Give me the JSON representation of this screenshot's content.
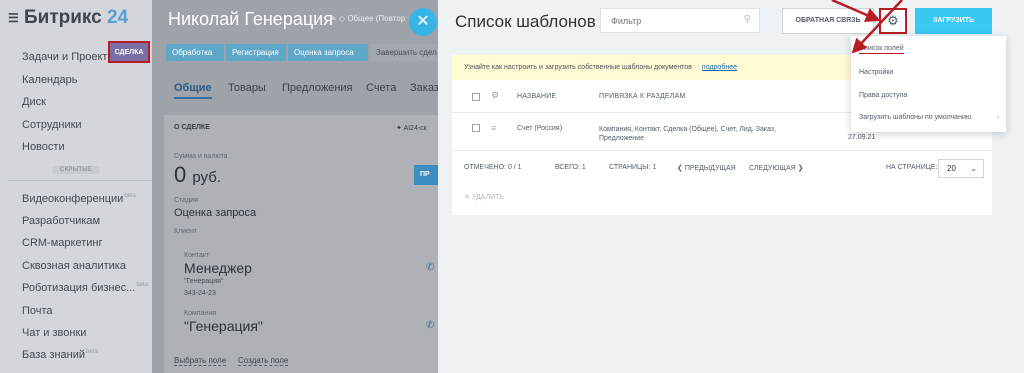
{
  "sidebar": {
    "brand": "Битрикс",
    "brand_number": "24",
    "deal_badge": "СДЕЛКА",
    "items_top": [
      "Задачи и Проекты",
      "Календарь",
      "Диск",
      "Сотрудники",
      "Новости"
    ],
    "hidden_label": "СКРЫТЫЕ",
    "items_hidden": [
      {
        "label": "Видеоконференции",
        "tag": "beta"
      },
      {
        "label": "Разработчикам",
        "tag": ""
      },
      {
        "label": "CRM-маркетинг",
        "tag": ""
      },
      {
        "label": "Сквозная аналитика",
        "tag": ""
      },
      {
        "label": "Роботизация бизнес...",
        "tag": "beta"
      },
      {
        "label": "Почта",
        "tag": ""
      },
      {
        "label": "Чат и звонки",
        "tag": ""
      },
      {
        "label": "База знаний",
        "tag": "beta"
      }
    ]
  },
  "deal": {
    "title": "Николай Генерация",
    "title_tag": "Общее (Повтор",
    "stages": [
      "Обработка",
      "Регистрация",
      "Оценка запроса",
      "Завершить сдел"
    ],
    "tabs": [
      "Общие",
      "Товары",
      "Предложения",
      "Счета",
      "Заказ"
    ],
    "section": "О СДЕЛКЕ",
    "ai": "AI24-ск",
    "amount_label": "Сумма и валюта",
    "amount_value": "0",
    "amount_currency": "руб.",
    "stage_label": "Стадия",
    "stage_value": "Оценка запроса",
    "client_label": "Клиент",
    "contact_label": "Контакт",
    "contact_name": "Менеджер",
    "contact_company": "\"Генерация\"",
    "contact_phone": "343-24-23",
    "company_label": "Компания",
    "company_name": "\"Генерация\"",
    "btn_short": "ПР",
    "link_select": "Выбрать поле",
    "link_create": "Создать поле"
  },
  "templates": {
    "title": "Список шаблонов",
    "filter_placeholder": "Фильтр",
    "feedback_btn": "ОБРАТНАЯ СВЯЗЬ",
    "upload_btn": "ЗАГРУЗИТЬ",
    "info_text": "Узнайте как настроить и загрузить собственные шаблоны документов",
    "info_link": "подробнее",
    "col_name": "НАЗВАНИЕ",
    "col_binding": "ПРИВЯЗКА К РАЗДЕЛАМ",
    "row": {
      "name": "Счет (Россия)",
      "binding": "Компания, Контакт, Сделка (Общее), Счет, Лид, Заказ, Предложение",
      "date_partial": "27.09.21"
    },
    "footer": {
      "selected": "ОТМЕЧЕНО: 0 / 1",
      "total": "ВСЕГО: 1",
      "pages": "СТРАНИЦЫ: 1",
      "prev": "ПРЕДЫДУЩАЯ",
      "next": "СЛЕДУЮЩАЯ",
      "per_page_label": "НА СТРАНИЦЕ:",
      "per_page_value": "20"
    },
    "delete": "УДАЛИТЬ"
  },
  "menu": {
    "items": [
      "Список полей",
      "Настройки",
      "Права доступа",
      "Загрузить шаблоны по умолчанию"
    ]
  },
  "icons": {
    "close": "close-icon",
    "gear": "gear-icon",
    "search": "search-icon"
  },
  "colors": {
    "accent_red": "#b81d24",
    "upload_blue": "#3bc8f5",
    "close_blue": "#39b4e6"
  }
}
